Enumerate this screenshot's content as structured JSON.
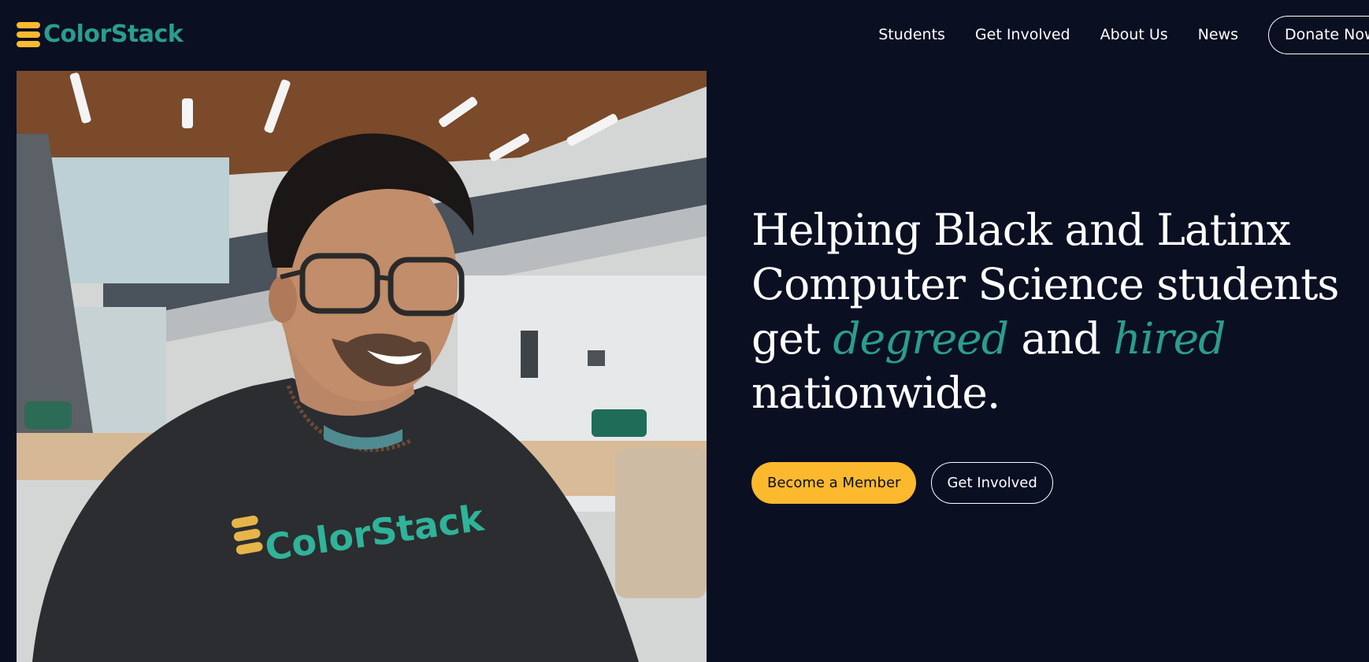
{
  "brand": {
    "name": "ColorStack",
    "logo_icon": "colorstack-stripes-icon",
    "primary_color": "#2a9d8f",
    "accent_color": "#fdb92e",
    "background_color": "#0a0f22"
  },
  "nav": {
    "items": [
      {
        "label": "Students"
      },
      {
        "label": "Get Involved"
      },
      {
        "label": "About Us"
      },
      {
        "label": "News"
      }
    ],
    "donate_label": "Donate Now"
  },
  "hero": {
    "headline": {
      "line1": "Helping Black and Latinx",
      "line2": "Computer Science students",
      "line3_pre": "get ",
      "line3_accent1": "degreed",
      "line3_mid": " and ",
      "line3_accent2": "hired",
      "line4": "nationwide."
    },
    "primary_cta": "Become a Member",
    "secondary_cta": "Get Involved",
    "photo_shirt_text": "ColorStack"
  }
}
